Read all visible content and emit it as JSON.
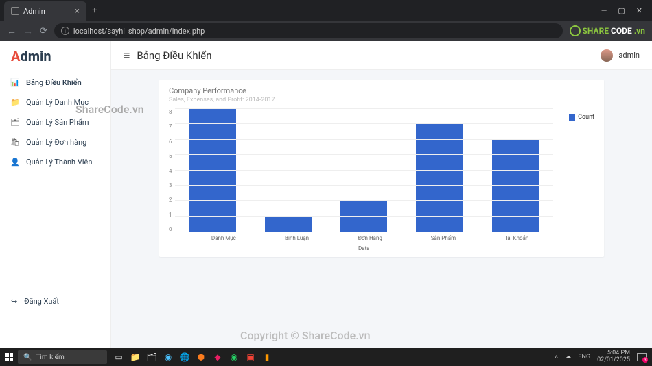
{
  "browser": {
    "tab_title": "Admin",
    "url": "localhost/sayhi_shop/admin/index.php",
    "logo_text_share": "SHARE",
    "logo_text_code": "CODE",
    "logo_text_vn": ".vn"
  },
  "sidebar": {
    "brand_a": "A",
    "brand_dmin": "dmin",
    "items": [
      {
        "icon": "📊",
        "label": "Bảng Điều Khiển"
      },
      {
        "icon": "📁",
        "label": "Quản Lý Danh Mục"
      },
      {
        "icon": "🗂",
        "label": "Quản Lý Sản Phẩm"
      },
      {
        "icon": "🛍",
        "label": "Quản Lý Đơn hàng"
      },
      {
        "icon": "👤",
        "label": "Quản Lý Thành Viên"
      }
    ],
    "logout_icon": "↪",
    "logout_label": "Đăng Xuất"
  },
  "header": {
    "page_title": "Bảng Điều Khiển",
    "user_name": "admin"
  },
  "card": {
    "title": "Company Performance",
    "subtitle": "Sales, Expenses, and Profit: 2014-2017"
  },
  "chart_data": {
    "type": "bar",
    "title": "Company Performance",
    "subtitle": "Sales, Expenses, and Profit: 2014-2017",
    "categories": [
      "Danh Mục",
      "Bình Luận",
      "Đơn Hàng",
      "Sản Phẩm",
      "Tài Khoản"
    ],
    "values": [
      8,
      1,
      2,
      7,
      6
    ],
    "series_name": "Count",
    "xlabel": "Data",
    "ylabel": "",
    "ylim": [
      0,
      8
    ],
    "yticks": [
      "0",
      "1",
      "2",
      "3",
      "4",
      "5",
      "6",
      "7",
      "8"
    ]
  },
  "watermarks": {
    "wm1": "ShareCode.vn",
    "wm2": "Copyright © ShareCode.vn"
  },
  "taskbar": {
    "search_placeholder": "Tìm kiếm",
    "tray_lang": "ENG",
    "tray_net": "⌃  ㎝  ⚙",
    "time": "5:04 PM",
    "date": "02/01/2025"
  }
}
